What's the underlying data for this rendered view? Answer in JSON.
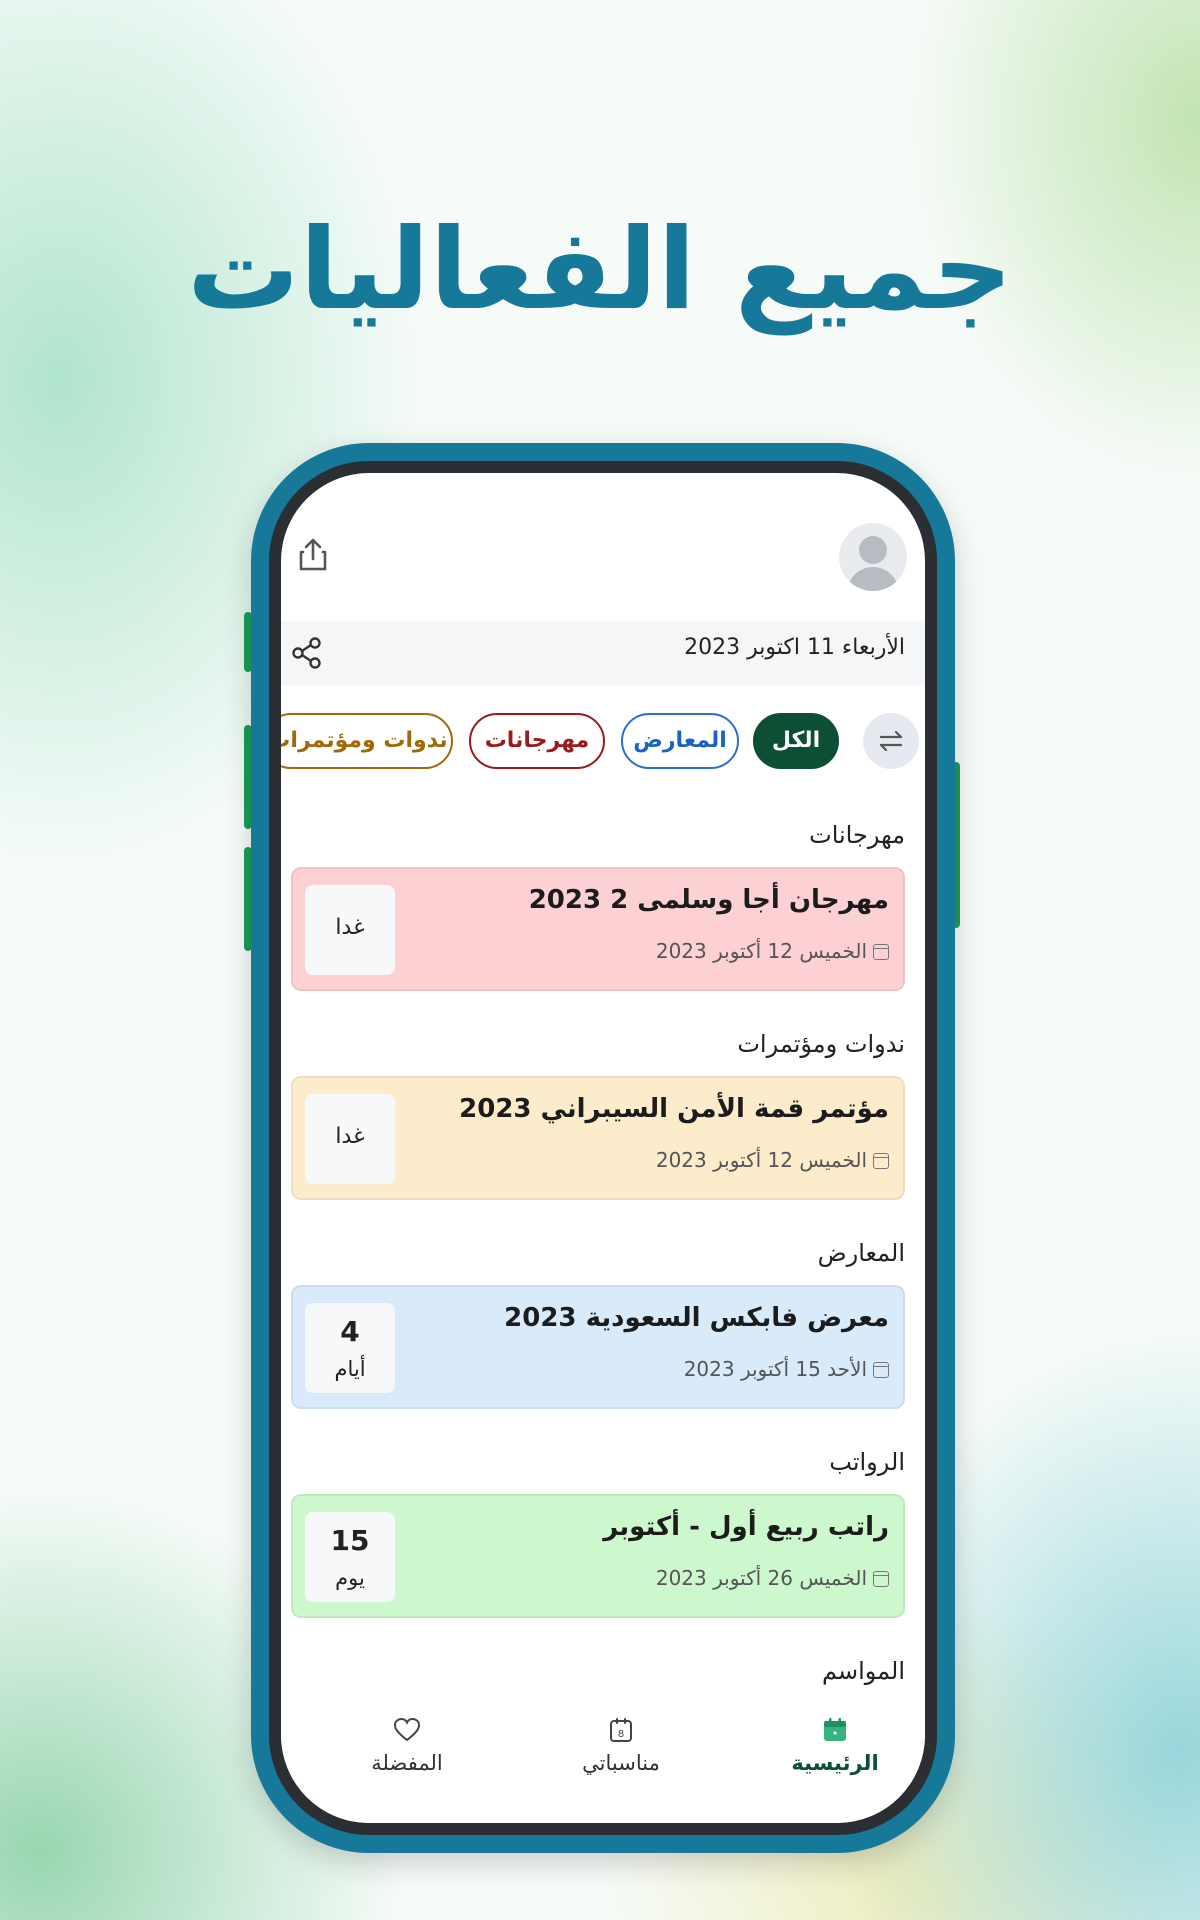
{
  "headline": "جميع الفعاليات",
  "header": {
    "date": "الأربعاء 11 اكتوبر 2023"
  },
  "filters": {
    "all": "الكل",
    "exhibitions": "المعارض",
    "festivals": "مهرجانات",
    "seminars": "ندوات ومؤتمرات"
  },
  "sections": [
    {
      "title": "مهرجانات",
      "event": {
        "title": "مهرجان أجا وسلمى 2 2023",
        "date": "الخميس 12 أكتوبر 2023",
        "badge": "غدا",
        "bg": "#fdd0d4"
      }
    },
    {
      "title": "ندوات ومؤتمرات",
      "event": {
        "title": "مؤتمر قمة الأمن السيبراني 2023",
        "date": "الخميس 12 أكتوبر 2023",
        "badge": "غدا",
        "bg": "#fdeccb"
      }
    },
    {
      "title": "المعارض",
      "event": {
        "title": "معرض فابكس السعودية 2023",
        "date": "الأحد 15 أكتوبر 2023",
        "badge_number": "4",
        "badge_unit": "أيام",
        "bg": "#d9eafb"
      }
    },
    {
      "title": "الرواتب",
      "event": {
        "title": "راتب ربيع أول - أكتوبر",
        "date": "الخميس 26 أكتوبر 2023",
        "badge_number": "15",
        "badge_unit": "يوم",
        "bg": "#cdf8cd"
      }
    },
    {
      "title": "المواسم"
    }
  ],
  "nav": {
    "home": "الرئيسية",
    "my_events": "مناسباتي",
    "favorites": "المفضلة",
    "calendar_day": "8"
  },
  "colors": {
    "brand": "#17799a",
    "active": "#0d4f35"
  }
}
